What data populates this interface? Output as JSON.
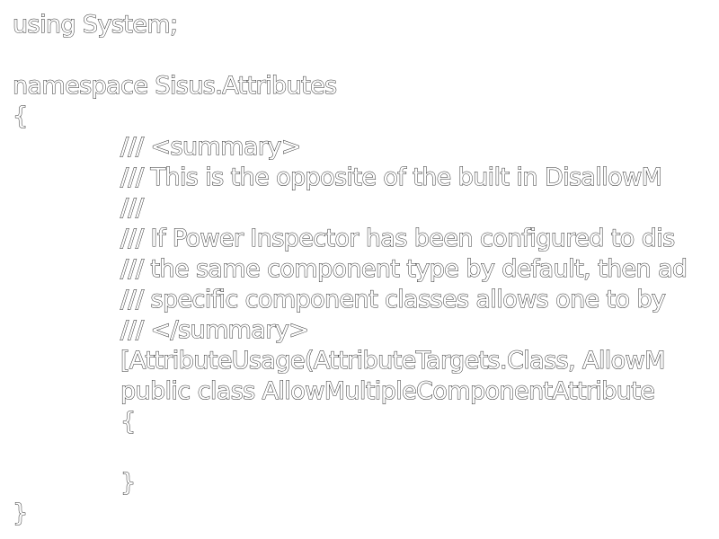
{
  "document": {
    "lines": [
      "using System;",
      "",
      "namespace Sisus.Attributes",
      "{",
      "/// <summary>",
      "/// This is the opposite of the built in DisallowM",
      "///",
      "/// If Power Inspector has been configured to dis",
      "/// the same component type by default, then ad",
      "/// specific component classes allows one to by",
      "/// </summary>",
      "[AttributeUsage(AttributeTargets.Class, AllowM",
      "public class AllowMultipleComponentAttribute",
      "{",
      "",
      "}",
      "}"
    ]
  }
}
